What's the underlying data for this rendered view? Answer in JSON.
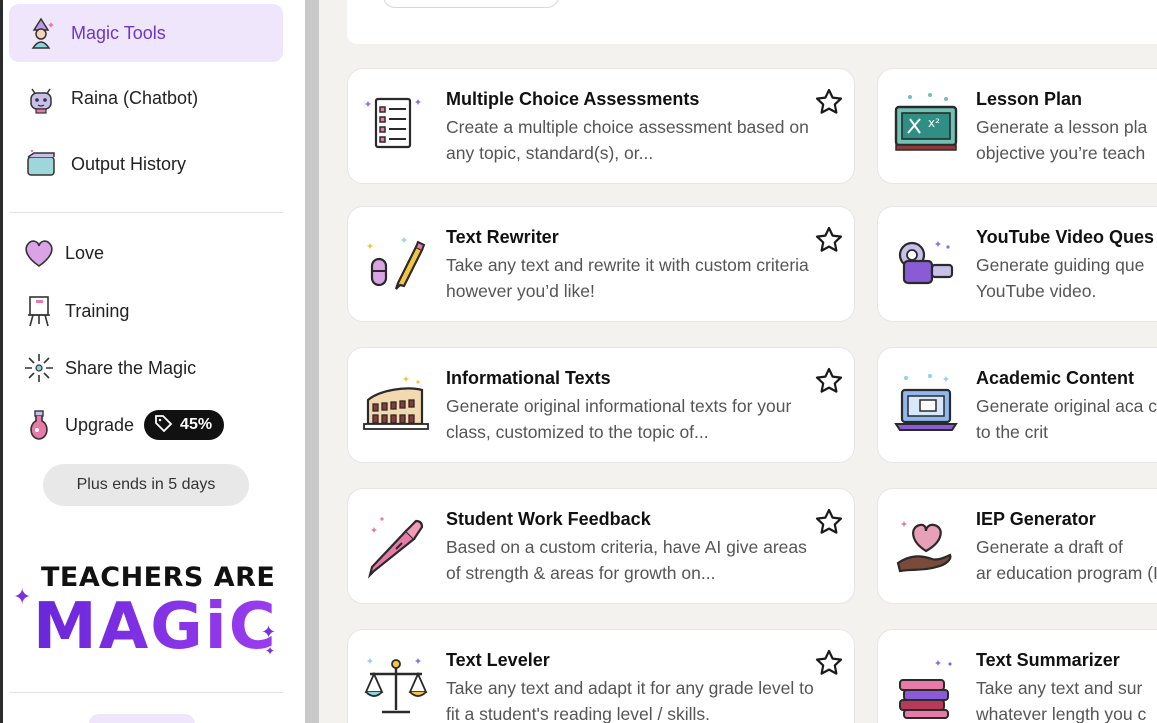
{
  "sidebar": {
    "nav": [
      {
        "label": "Magic Tools",
        "icon": "wizard-icon",
        "active": true
      },
      {
        "label": "Raina (Chatbot)",
        "icon": "chatbot-icon",
        "active": false
      },
      {
        "label": "Output History",
        "icon": "history-icon",
        "active": false
      }
    ],
    "links": [
      {
        "label": "Love",
        "icon": "heart-icon"
      },
      {
        "label": "Training",
        "icon": "easel-icon"
      },
      {
        "label": "Share the Magic",
        "icon": "sparkle-share-icon"
      },
      {
        "label": "Upgrade",
        "icon": "potion-icon"
      }
    ],
    "upgrade_badge": "45%",
    "plan_notice": "Plus ends in 5 days",
    "logo": {
      "line1": "TEACHERS ARE",
      "line2": "MAGiC"
    }
  },
  "tools": [
    {
      "title": "Multiple Choice Assessments",
      "desc": "Create a multiple choice assessment based on any topic, standard(s), or...",
      "icon": "checklist-icon"
    },
    {
      "title": "Lesson Plan",
      "desc": "Generate a lesson pla objective you’re teach",
      "icon": "chalkboard-icon"
    },
    {
      "title": "Text Rewriter",
      "desc": "Take any text and rewrite it with custom criteria however you’d like!",
      "icon": "pencil-eraser-icon"
    },
    {
      "title": "YouTube Video Ques",
      "desc": "Generate guiding que YouTube video.",
      "icon": "video-camera-icon"
    },
    {
      "title": "Informational Texts",
      "desc": "Generate original informational texts for your class, customized to the topic of...",
      "icon": "colosseum-icon"
    },
    {
      "title": "Academic Content",
      "desc": "Generate original aca customized to the crit",
      "icon": "laptop-icon"
    },
    {
      "title": "Student Work Feedback",
      "desc": "Based on a custom criteria, have AI give areas of strength & areas for growth on...",
      "icon": "pen-icon"
    },
    {
      "title": "IEP Generator",
      "desc": "Generate a draft of ar education program (II",
      "icon": "heart-hand-icon"
    },
    {
      "title": "Text Leveler",
      "desc": "Take any text and adapt it for any grade level to fit a student's reading level / skills.",
      "icon": "scales-icon"
    },
    {
      "title": "Text Summarizer",
      "desc": "Take any text and sur whatever length you c",
      "icon": "books-icon"
    }
  ],
  "colors": {
    "accent": "#6b36c9",
    "active_bg": "#efe6fb",
    "page_bg": "#f3f2ef"
  }
}
